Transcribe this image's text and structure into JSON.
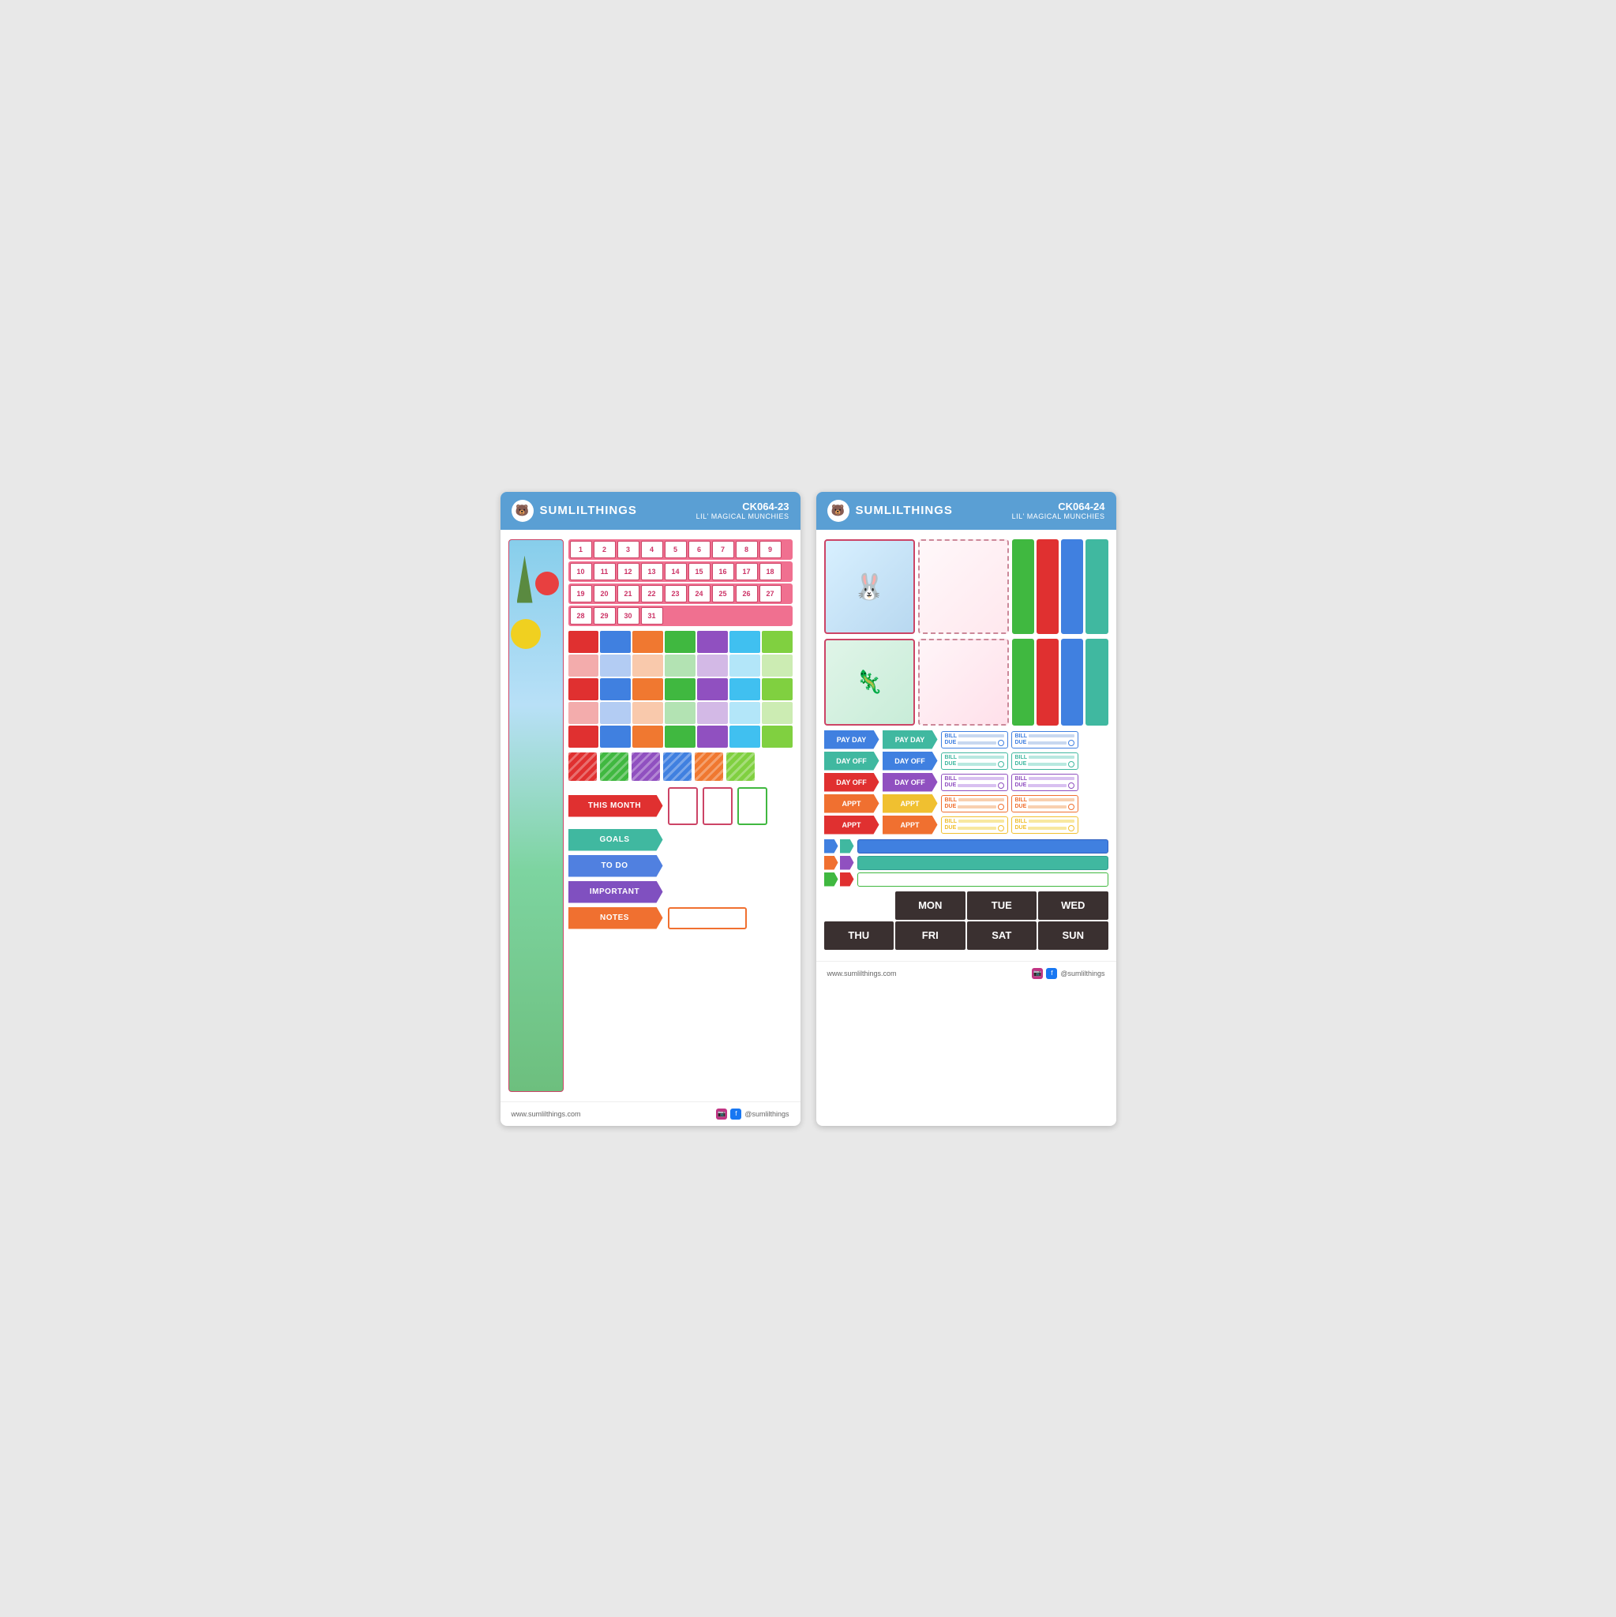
{
  "brand": "SUMLILTHINGS",
  "sheet1": {
    "code": "CK064-23",
    "subtitle": "LIL' MAGICAL MUNCHIES",
    "numbers": [
      [
        1,
        2,
        3,
        4,
        5,
        6,
        7,
        8,
        9
      ],
      [
        10,
        11,
        12,
        13,
        14,
        15,
        16,
        17,
        18
      ],
      [
        19,
        20,
        21,
        22,
        23,
        24,
        25,
        26,
        27
      ],
      [
        28,
        29,
        30,
        31,
        "",
        "",
        "",
        "",
        ""
      ]
    ],
    "labels": {
      "this_month": "THIS MONTH",
      "goals": "GOALS",
      "todo": "TO DO",
      "important": "IMPORTANT",
      "notes": "NOTES"
    }
  },
  "sheet2": {
    "code": "CK064-24",
    "subtitle": "LIL' MAGICAL MUNCHIES",
    "flag_labels": {
      "pay_day": "PAY DAY",
      "day_off": "DAY OFF",
      "appt": "APPT"
    },
    "bill_labels": {
      "bill": "BILL",
      "due": "DUE"
    },
    "days": {
      "row1": [
        "MON",
        "TUE",
        "WED"
      ],
      "row2": [
        "THU",
        "FRI",
        "SAT",
        "SUN"
      ]
    }
  },
  "footer": {
    "website": "www.sumlilthings.com",
    "social": "@sumlilthings"
  }
}
